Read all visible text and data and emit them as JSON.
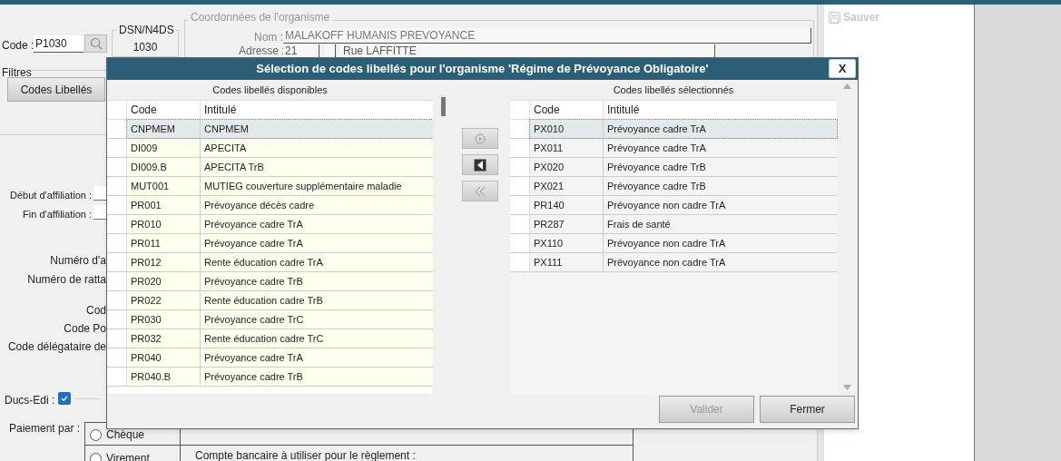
{
  "form": {
    "code_label": "Code :",
    "code_value": "P1030",
    "dsn_title": "DSN/N4DS",
    "dsn_value": "1030",
    "coord_title": "Coordonnées de l'organisme",
    "nom_label": "Nom :",
    "nom_value": "MALAKOFF HUMANIS PREVOYANCE",
    "adresse_label": "Adresse :",
    "adresse_number": "21",
    "adresse_street": "Rue LAFFITTE",
    "filters_title": "Filtres",
    "filters_button": "Codes Libellés",
    "date_labels": [
      "Début d'affiliation :",
      "Fin d'affiliation :"
    ],
    "cut_labels": [
      "Numéro d'a",
      "Numéro de ratta",
      "Cod",
      "Code Po",
      "Code délégataire de"
    ],
    "ducs_label": "Ducs-Edi :",
    "ducs_checked": true,
    "payment_label": "Paiement par :",
    "payment_options": [
      {
        "label": "Chèque",
        "selected": false
      },
      {
        "label": "Virement",
        "selected": false
      }
    ],
    "account_label": "Compte bancaire à utiliser pour le règlement :"
  },
  "side": {
    "save_label": "Sauver",
    "save_disabled": true
  },
  "dialog": {
    "title": "Sélection de codes libellés pour l'organisme 'Régime de Prévoyance Obligatoire'",
    "close": "X",
    "available": {
      "title": "Codes libellés disponibles",
      "columns": [
        "Code",
        "Intitulé"
      ],
      "rows": [
        {
          "code": "CNPMEM",
          "label": "CNPMEM",
          "selected": true
        },
        {
          "code": "DI009",
          "label": "APECITA",
          "selected": false
        },
        {
          "code": "DI009.B",
          "label": "APECITA TrB",
          "selected": false
        },
        {
          "code": "MUT001",
          "label": "MUTIEG couverture supplémentaire maladie",
          "selected": false
        },
        {
          "code": "PR001",
          "label": "Prévoyance décès cadre",
          "selected": false
        },
        {
          "code": "PR010",
          "label": "Prévoyance cadre TrA",
          "selected": false
        },
        {
          "code": "PR011",
          "label": "Prévoyance cadre TrA",
          "selected": false
        },
        {
          "code": "PR012",
          "label": "Rente éducation cadre TrA",
          "selected": false
        },
        {
          "code": "PR020",
          "label": "Prévoyance cadre TrB",
          "selected": false
        },
        {
          "code": "PR022",
          "label": "Rente éducation cadre TrB",
          "selected": false
        },
        {
          "code": "PR030",
          "label": "Prévoyance cadre TrC",
          "selected": false
        },
        {
          "code": "PR032",
          "label": "Rente éducation cadre TrC",
          "selected": false
        },
        {
          "code": "PR040",
          "label": "Prévoyance cadre TrA",
          "selected": false
        },
        {
          "code": "PR040.B",
          "label": "Prévoyance cadre TrB",
          "selected": false
        }
      ]
    },
    "selected_list": {
      "title": "Codes libellés sélectionnés",
      "columns": [
        "Code",
        "Intitulé"
      ],
      "rows": [
        {
          "code": "PX010",
          "label": "Prévoyance cadre TrA",
          "selected": true
        },
        {
          "code": "PX011",
          "label": "Prévoyance cadre TrA",
          "selected": false
        },
        {
          "code": "PX020",
          "label": "Prévoyance cadre TrB",
          "selected": false
        },
        {
          "code": "PX021",
          "label": "Prévoyance cadre TrB",
          "selected": false
        },
        {
          "code": "PR140",
          "label": "Prévoyance non cadre TrA",
          "selected": false
        },
        {
          "code": "PR287",
          "label": "Frais de santé",
          "selected": false
        },
        {
          "code": "PX110",
          "label": "Prévoyance non cadre TrA",
          "selected": false
        },
        {
          "code": "PX111",
          "label": "Prévoyance non cadre TrA",
          "selected": false
        }
      ]
    },
    "buttons": [
      {
        "label": "Valider",
        "disabled": true
      },
      {
        "label": "Fermer",
        "disabled": false
      }
    ]
  }
}
